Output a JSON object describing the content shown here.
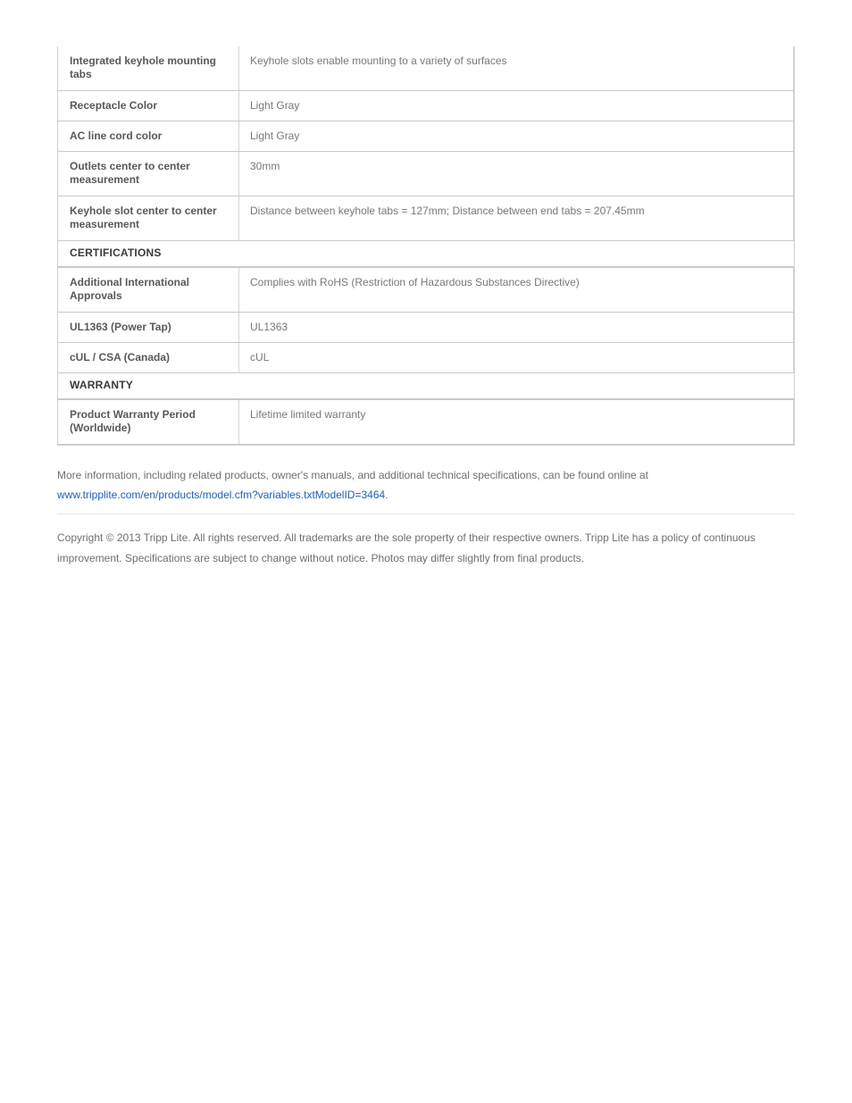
{
  "spec_table": {
    "rows": [
      {
        "type": "spec",
        "height": "tall",
        "label": "Integrated keyhole mounting tabs",
        "value": "Keyhole slots enable mounting to a variety of surfaces"
      },
      {
        "type": "spec",
        "height": "short",
        "label": "Receptacle Color",
        "value": "Light Gray"
      },
      {
        "type": "spec",
        "height": "short",
        "label": "AC line cord color",
        "value": "Light Gray"
      },
      {
        "type": "spec",
        "height": "tall",
        "label": "Outlets center to center measurement",
        "value": "30mm"
      },
      {
        "type": "spec",
        "height": "tall",
        "label": "Keyhole slot center to center measurement",
        "value": "Distance between keyhole tabs = 127mm; Distance between end tabs = 207.45mm"
      },
      {
        "type": "section",
        "label": "CERTIFICATIONS"
      },
      {
        "type": "spec",
        "height": "tall",
        "label": "Additional International Approvals",
        "value": "Complies with RoHS (Restriction of Hazardous Substances Directive)"
      },
      {
        "type": "spec",
        "height": "short",
        "label": "UL1363 (Power Tap)",
        "value": "UL1363"
      },
      {
        "type": "spec",
        "height": "short",
        "label": "cUL / CSA (Canada)",
        "value": "cUL"
      },
      {
        "type": "section",
        "label": "WARRANTY"
      },
      {
        "type": "spec",
        "height": "tall",
        "label": "Product Warranty Period (Worldwide)",
        "value": "Lifetime limited warranty"
      }
    ]
  },
  "footer": {
    "more_info_text": "More information, including related products, owner's manuals, and additional technical specifications, can be found online at",
    "link_text": "www.tripplite.com/en/products/model.cfm?variables.txtModelID=3464",
    "link_trailing_period": ".",
    "copyright": "Copyright © 2013 Tripp Lite. All rights reserved. All trademarks are the sole property of their respective owners. Tripp Lite has a policy of continuous improvement. Specifications are subject to change without notice. Photos may differ slightly from final products."
  },
  "colors": {
    "label_text": "#58595b",
    "value_text": "#77787b",
    "section_text": "#3a3a3a",
    "link": "#1c5fbe",
    "border": "#c9c9c9",
    "footer_text": "#6e6f71"
  }
}
